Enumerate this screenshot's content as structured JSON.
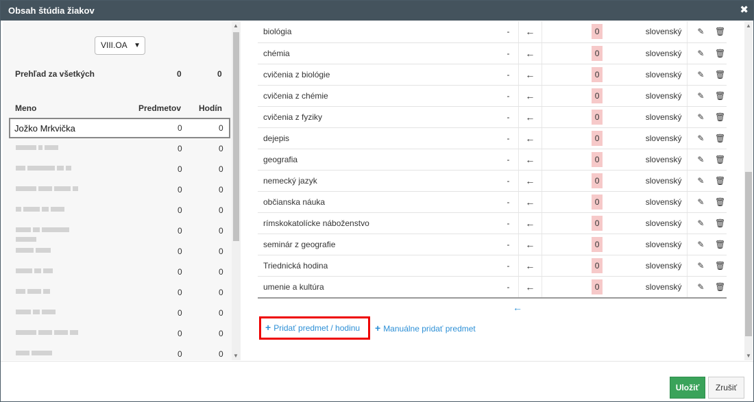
{
  "dialog": {
    "title": "Obsah štúdia žiakov",
    "close_icon": "close-icon"
  },
  "left": {
    "class_select": {
      "value": "VIII.OA"
    },
    "overview": {
      "label": "Prehľad za všetkých",
      "subjects": "0",
      "hours": "0"
    },
    "columns": {
      "name": "Meno",
      "subjects": "Predmetov",
      "hours": "Hodín"
    },
    "students": [
      {
        "name": "Jožko Mrkvička",
        "subjects": "0",
        "hours": "0",
        "selected": true
      },
      {
        "name": "",
        "subjects": "0",
        "hours": "0"
      },
      {
        "name": "",
        "subjects": "0",
        "hours": "0"
      },
      {
        "name": "",
        "subjects": "0",
        "hours": "0"
      },
      {
        "name": "",
        "subjects": "0",
        "hours": "0"
      },
      {
        "name": "",
        "subjects": "0",
        "hours": "0"
      },
      {
        "name": "",
        "subjects": "0",
        "hours": "0"
      },
      {
        "name": "",
        "subjects": "0",
        "hours": "0"
      },
      {
        "name": "",
        "subjects": "0",
        "hours": "0"
      },
      {
        "name": "",
        "subjects": "0",
        "hours": "0"
      },
      {
        "name": "",
        "subjects": "0",
        "hours": "0"
      },
      {
        "name": "",
        "subjects": "0",
        "hours": "0"
      }
    ]
  },
  "subjects": [
    {
      "name": "biológia",
      "dash": "-",
      "count": "0",
      "language": "slovenský"
    },
    {
      "name": "chémia",
      "dash": "-",
      "count": "0",
      "language": "slovenský"
    },
    {
      "name": "cvičenia z biológie",
      "dash": "-",
      "count": "0",
      "language": "slovenský"
    },
    {
      "name": "cvičenia z chémie",
      "dash": "-",
      "count": "0",
      "language": "slovenský"
    },
    {
      "name": "cvičenia z fyziky",
      "dash": "-",
      "count": "0",
      "language": "slovenský"
    },
    {
      "name": "dejepis",
      "dash": "-",
      "count": "0",
      "language": "slovenský"
    },
    {
      "name": "geografia",
      "dash": "-",
      "count": "0",
      "language": "slovenský"
    },
    {
      "name": "nemecký jazyk",
      "dash": "-",
      "count": "0",
      "language": "slovenský"
    },
    {
      "name": "občianska náuka",
      "dash": "-",
      "count": "0",
      "language": "slovenský"
    },
    {
      "name": "rímskokatolícke náboženstvo",
      "dash": "-",
      "count": "0",
      "language": "slovenský"
    },
    {
      "name": "seminár z geografie",
      "dash": "-",
      "count": "0",
      "language": "slovenský"
    },
    {
      "name": "Triednická hodina",
      "dash": "-",
      "count": "0",
      "language": "slovenský"
    },
    {
      "name": "umenie a kultúra",
      "dash": "-",
      "count": "0",
      "language": "slovenský"
    }
  ],
  "actions": {
    "add_label": "Pridať predmet / hodinu",
    "manual_label": "Manuálne pridať predmet"
  },
  "footer": {
    "save_label": "Uložiť",
    "cancel_label": "Zrušiť"
  },
  "icons": {
    "arrow": "←",
    "edit": "✎",
    "delete": "🗑",
    "plus": "+"
  },
  "colors": {
    "titlebar": "#44535d",
    "accent": "#2c8fd6",
    "save": "#3aa35a",
    "count_bg": "#f6c9c9",
    "highlight": "#e00000"
  }
}
